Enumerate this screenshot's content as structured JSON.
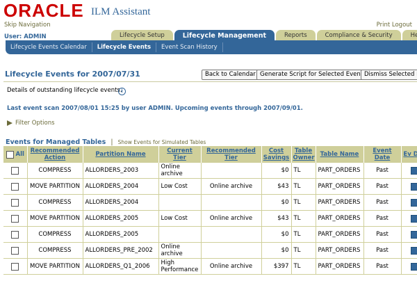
{
  "header": {
    "logo_text": "ORACLE",
    "app_name": "ILM Assistant",
    "skip_navigation": "Skip Navigation",
    "print_logout": "Print Logout",
    "user": "User: ADMIN"
  },
  "tabs": [
    {
      "label": "Lifecycle Setup"
    },
    {
      "label": "Lifecycle Management"
    },
    {
      "label": "Reports"
    },
    {
      "label": "Compliance & Security"
    },
    {
      "label": "Help"
    }
  ],
  "subnav": [
    {
      "label": "Lifecycle Events Calendar"
    },
    {
      "label": "Lifecycle Events"
    },
    {
      "label": "Event Scan History"
    }
  ],
  "page": {
    "title": "Lifecycle Events for 2007/07/31",
    "back_button": "Back to Calendar",
    "generate_button": "Generate Script for Selected Events",
    "dismiss_button": "Dismiss Selected Ev",
    "details": "Details of outstanding lifecycle events.",
    "info_icon_glyph": "i",
    "last_scan": "Last event scan 2007/08/01 15:25 by user ADMIN.  Upcoming events through 2007/09/01.",
    "filter_options": "Filter Options",
    "events_managed": "Events for Managed Tables",
    "events_separator": "|",
    "events_simulated": "Show Events for Simulated Tables"
  },
  "table": {
    "headers": {
      "all": "All",
      "recommended_action": "Recommended Action",
      "partition_name": "Partition Name",
      "current_tier": "Current Tier",
      "recommended_tier": "Recommended Tier",
      "cost_savings": "Cost Savings",
      "table_owner": "Table Owner",
      "table_name": "Table Name",
      "event_date": "Event Date",
      "event_details": "Ev Det"
    },
    "rows": [
      {
        "action": "COMPRESS",
        "partition": "ALLORDERS_2003",
        "current": "Online archive",
        "recommended": "",
        "savings": "$0",
        "owner": "TL",
        "table": "PART_ORDERS",
        "date": "Past"
      },
      {
        "action": "MOVE PARTITION",
        "partition": "ALLORDERS_2004",
        "current": "Low Cost",
        "recommended": "Online archive",
        "savings": "$43",
        "owner": "TL",
        "table": "PART_ORDERS",
        "date": "Past"
      },
      {
        "action": "COMPRESS",
        "partition": "ALLORDERS_2004",
        "current": "",
        "recommended": "",
        "savings": "$0",
        "owner": "TL",
        "table": "PART_ORDERS",
        "date": "Past"
      },
      {
        "action": "MOVE PARTITION",
        "partition": "ALLORDERS_2005",
        "current": "Low Cost",
        "recommended": "Online archive",
        "savings": "$43",
        "owner": "TL",
        "table": "PART_ORDERS",
        "date": "Past"
      },
      {
        "action": "COMPRESS",
        "partition": "ALLORDERS_2005",
        "current": "",
        "recommended": "",
        "savings": "$0",
        "owner": "TL",
        "table": "PART_ORDERS",
        "date": "Past"
      },
      {
        "action": "COMPRESS",
        "partition": "ALLORDERS_PRE_2002",
        "current": "Online archive",
        "recommended": "",
        "savings": "$0",
        "owner": "TL",
        "table": "PART_ORDERS",
        "date": "Past"
      },
      {
        "action": "MOVE PARTITION",
        "partition": "ALLORDERS_Q1_2006",
        "current": "High Performance",
        "recommended": "Online archive",
        "savings": "$397",
        "owner": "TL",
        "table": "PART_ORDERS",
        "date": "Past"
      }
    ]
  },
  "colors": {
    "brand_red": "#cc0000",
    "accent_blue": "#336699",
    "tab_khaki": "#cfcf9a"
  }
}
